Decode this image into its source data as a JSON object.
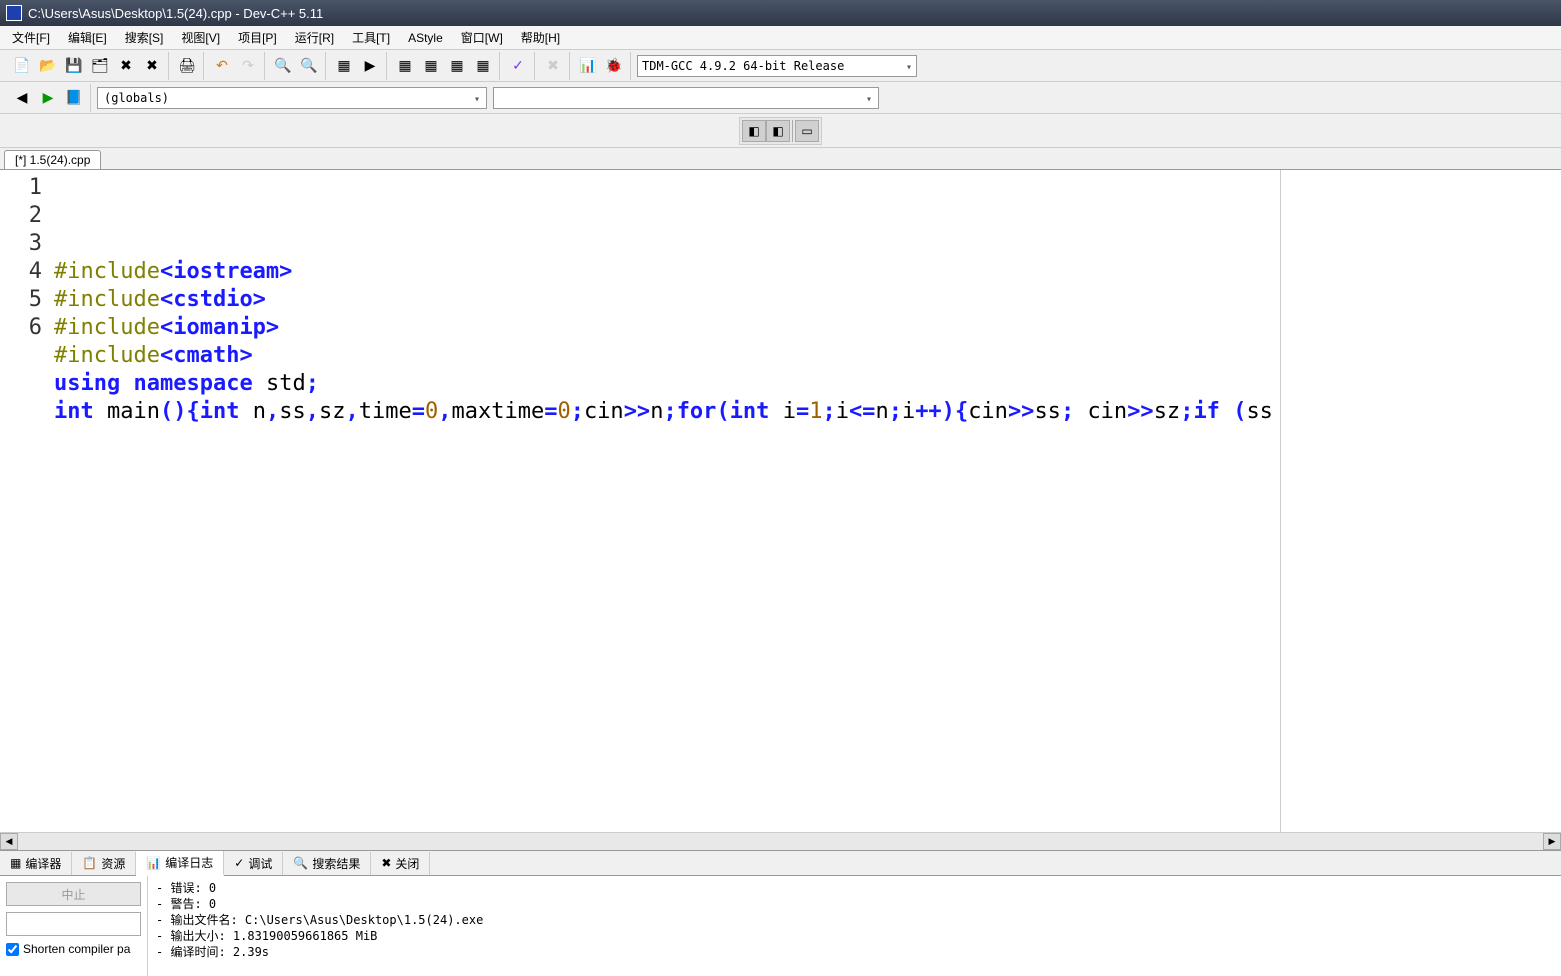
{
  "title": "C:\\Users\\Asus\\Desktop\\1.5(24).cpp - Dev-C++ 5.11",
  "menus": [
    "文件[F]",
    "编辑[E]",
    "搜索[S]",
    "视图[V]",
    "项目[P]",
    "运行[R]",
    "工具[T]",
    "AStyle",
    "窗口[W]",
    "帮助[H]"
  ],
  "compiler_selected": "TDM-GCC 4.9.2 64-bit Release",
  "scope_selected": "(globals)",
  "tab_label": "[*] 1.5(24).cpp",
  "code_lines": [
    {
      "n": "1",
      "html": "<span class='pp'>#include</span><span class='kw'>&lt;iostream&gt;</span>"
    },
    {
      "n": "2",
      "html": "<span class='pp'>#include</span><span class='kw'>&lt;cstdio&gt;</span>"
    },
    {
      "n": "3",
      "html": "<span class='pp'>#include</span><span class='kw'>&lt;iomanip&gt;</span>"
    },
    {
      "n": "4",
      "html": "<span class='pp'>#include</span><span class='kw'>&lt;cmath&gt;</span>"
    },
    {
      "n": "5",
      "html": "<span class='kw'>using</span> <span class='kw'>namespace</span> <span class='id'>std</span><span class='kw'>;</span>"
    },
    {
      "n": "6",
      "html": "<span class='kw'>int</span> <span class='id'>main</span><span class='kw'>()</span><span class='kw'>{</span><span class='kw'>int</span> <span class='id'>n</span><span class='kw'>,</span><span class='id'>ss</span><span class='kw'>,</span><span class='id'>sz</span><span class='kw'>,</span><span class='id'>time</span><span class='kw'>=</span><span class='num'>0</span><span class='kw'>,</span><span class='id'>maxtime</span><span class='kw'>=</span><span class='num'>0</span><span class='kw'>;</span><span class='id'>cin</span><span class='kw'>&gt;&gt;</span><span class='id'>n</span><span class='kw'>;</span><span class='kw'>for</span><span class='kw'>(</span><span class='kw'>int</span> <span class='id'>i</span><span class='kw'>=</span><span class='num'>1</span><span class='kw'>;</span><span class='id'>i</span><span class='kw'>&lt;=</span><span class='id'>n</span><span class='kw'>;</span><span class='id'>i</span><span class='kw'>++)</span><span class='kw'>{</span><span class='id'>cin</span><span class='kw'>&gt;&gt;</span><span class='id'>ss</span><span class='kw'>;</span> <span class='id'>cin</span><span class='kw'>&gt;&gt;</span><span class='id'>sz</span><span class='kw'>;</span><span class='kw'>if</span> <span class='kw'>(</span><span class='id'>ss</span>"
    }
  ],
  "bottom_tabs": [
    {
      "icon": "grid",
      "label": "编译器"
    },
    {
      "icon": "copy",
      "label": "资源"
    },
    {
      "icon": "chart",
      "label": "编译日志",
      "active": true
    },
    {
      "icon": "check",
      "label": "调试"
    },
    {
      "icon": "search",
      "label": "搜索结果"
    },
    {
      "icon": "close",
      "label": "关闭"
    }
  ],
  "stop_label": "中止",
  "shorten_label": "Shorten compiler pa",
  "log_lines": [
    "- 错误: 0",
    "- 警告: 0",
    "- 输出文件名: C:\\Users\\Asus\\Desktop\\1.5(24).exe",
    "- 输出大小: 1.83190059661865 MiB",
    "- 编译时间: 2.39s"
  ]
}
